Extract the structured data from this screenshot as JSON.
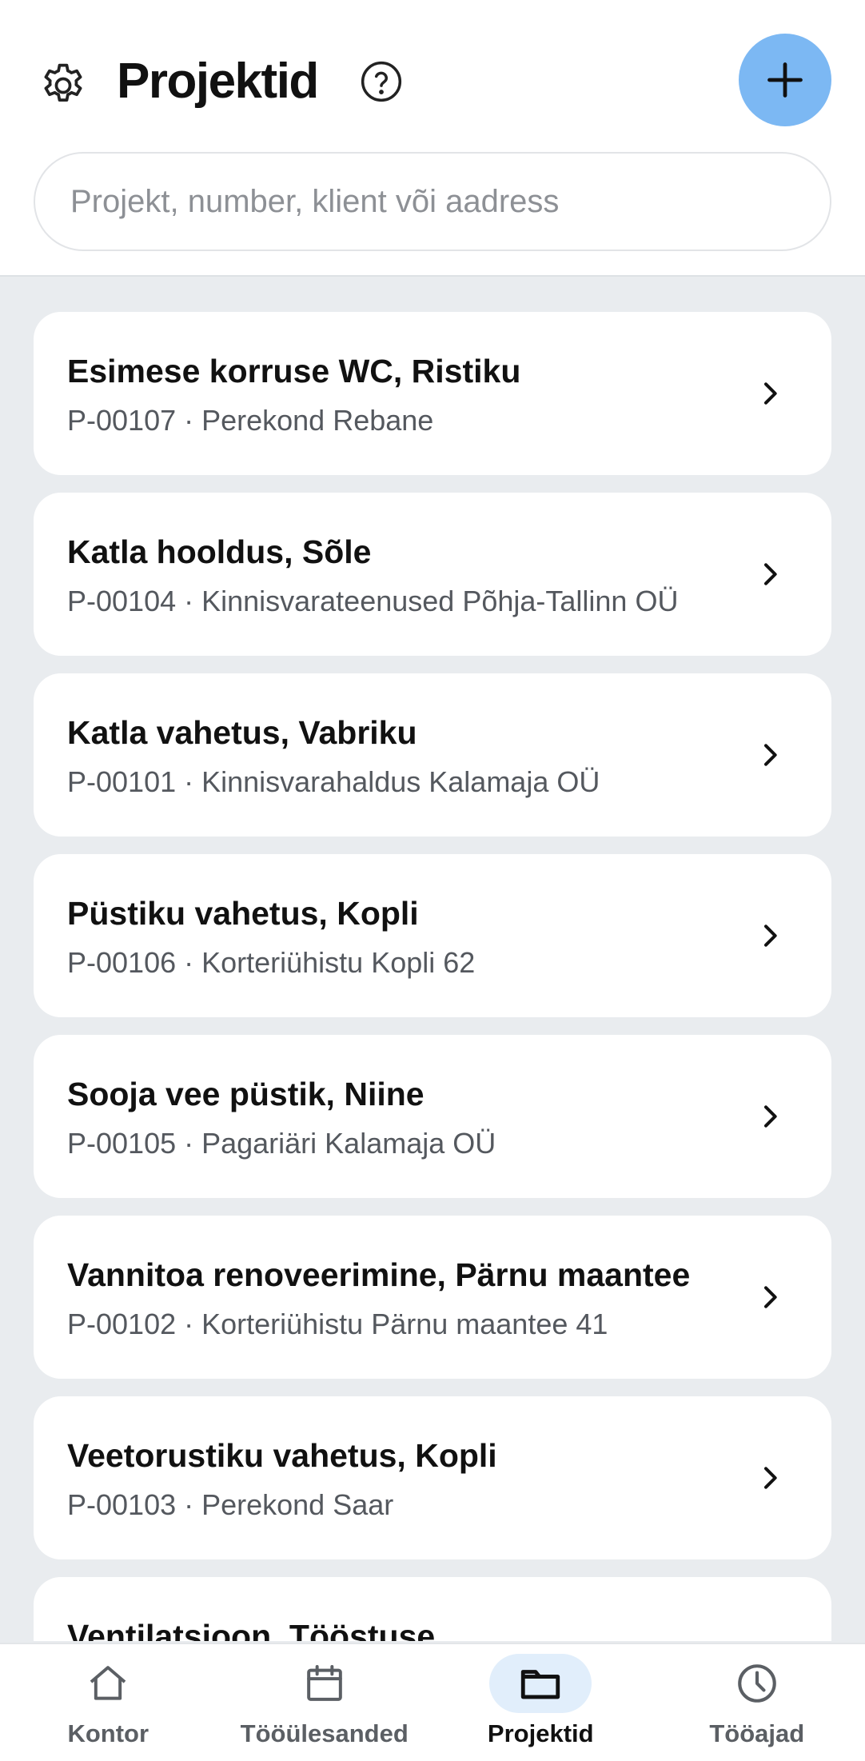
{
  "header": {
    "title": "Projektid",
    "search": {
      "placeholder": "Projekt, number, klient või aadress",
      "value": ""
    },
    "add_button_icon": "plus-icon",
    "accent_color": "#7cb8f3"
  },
  "projects": [
    {
      "title": "Esimese korruse WC, Ristiku",
      "subtitle": "P-00107 · Perekond Rebane"
    },
    {
      "title": "Katla hooldus, Sõle",
      "subtitle": "P-00104 · Kinnisvarateenused Põhja-Tallinn OÜ"
    },
    {
      "title": "Katla vahetus, Vabriku",
      "subtitle": "P-00101 · Kinnisvarahaldus Kalamaja OÜ"
    },
    {
      "title": "Püstiku vahetus, Kopli",
      "subtitle": "P-00106 · Korteriühistu Kopli 62"
    },
    {
      "title": "Sooja vee püstik, Niine",
      "subtitle": "P-00105 · Pagariäri Kalamaja OÜ"
    },
    {
      "title": "Vannitoa renoveerimine, Pärnu maantee",
      "subtitle": "P-00102 · Korteriühistu Pärnu maantee 41"
    },
    {
      "title": "Veetorustiku vahetus, Kopli",
      "subtitle": "P-00103 · Perekond Saar"
    },
    {
      "title": "Ventilatsioon, Tööstuse",
      "subtitle": ""
    }
  ],
  "nav": [
    {
      "label": "Kontor",
      "icon": "home-icon",
      "active": false
    },
    {
      "label": "Tööülesanded",
      "icon": "calendar-icon",
      "active": false
    },
    {
      "label": "Projektid",
      "icon": "folder-icon",
      "active": true
    },
    {
      "label": "Tööajad",
      "icon": "clock-icon",
      "active": false
    }
  ]
}
